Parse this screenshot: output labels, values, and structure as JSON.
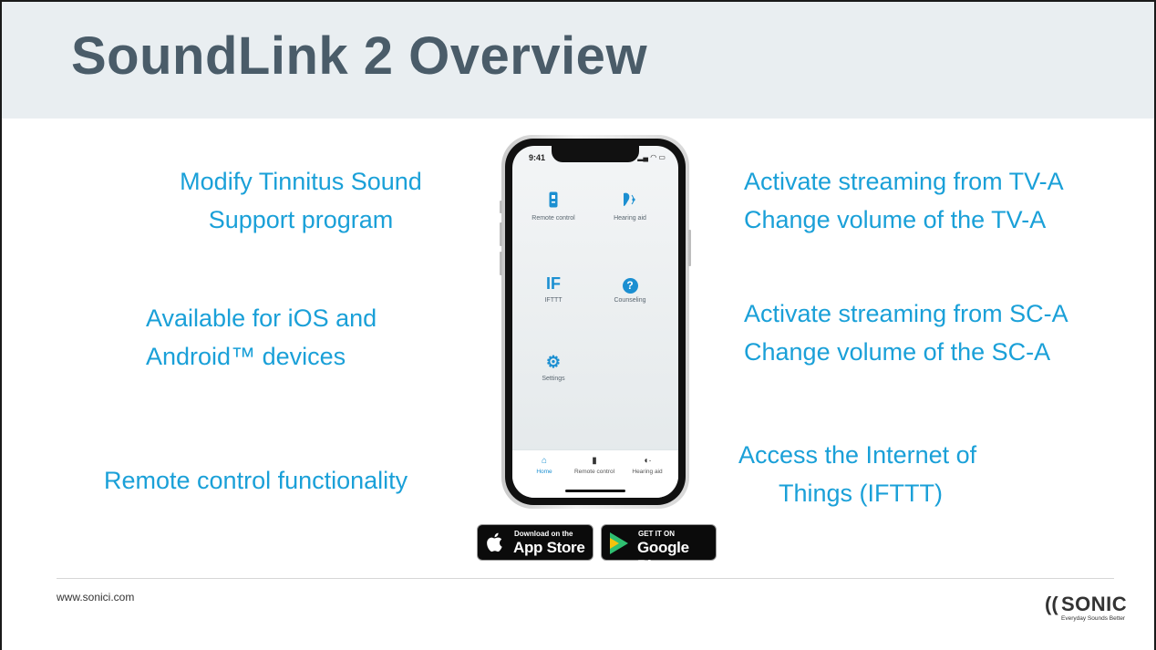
{
  "slide": {
    "title": "SoundLink 2 Overview",
    "left_features": [
      {
        "line1": "Modify Tinnitus Sound",
        "line2": "Support program"
      },
      {
        "line1": "Available for iOS and",
        "line2": "Android™ devices"
      },
      {
        "line1": "Remote control functionality"
      }
    ],
    "right_features": [
      {
        "line1": "Activate streaming from TV-A",
        "line2": "Change volume of the TV-A"
      },
      {
        "line1": "Activate streaming from SC-A",
        "line2": "Change volume of the SC-A"
      },
      {
        "line1": "Access the Internet of",
        "line2": "Things  (IFTTT)"
      }
    ],
    "colors": {
      "accent": "#1aa0d8",
      "title": "#4a5c69",
      "header_bg": "#e9eef1"
    }
  },
  "phone": {
    "status_time": "9:41",
    "tiles": [
      {
        "label": "Remote control",
        "icon": "remote-icon"
      },
      {
        "label": "Hearing aid",
        "icon": "hearing-aid-icon"
      },
      {
        "label": "IFTTT",
        "icon": "ifttt-icon",
        "glyph": "IF"
      },
      {
        "label": "Counseling",
        "icon": "question-icon",
        "glyph": "?"
      },
      {
        "label": "Settings",
        "icon": "gear-icon"
      }
    ],
    "tabs": [
      {
        "label": "Home",
        "icon": "home-icon",
        "active": true
      },
      {
        "label": "Remote control",
        "icon": "remote-icon"
      },
      {
        "label": "Hearing aid",
        "icon": "hearing-aid-icon"
      }
    ]
  },
  "badges": {
    "appstore": {
      "small": "Download on the",
      "big": "App Store"
    },
    "googleplay": {
      "small": "GET IT ON",
      "big": "Google Play"
    }
  },
  "footer": {
    "url": "www.sonici.com",
    "brand": "SONIC",
    "tagline": "Everyday Sounds Better"
  }
}
